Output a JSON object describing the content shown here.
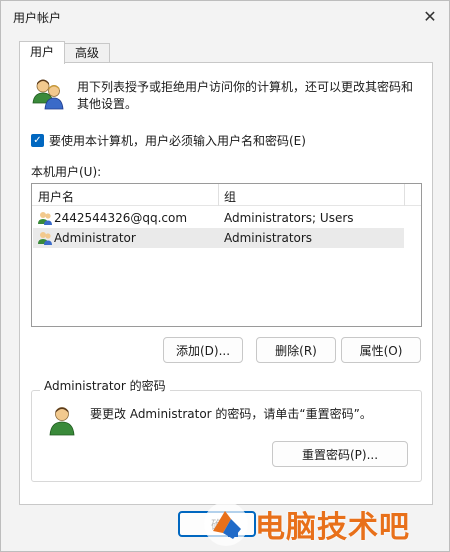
{
  "window": {
    "title": "用户帐户",
    "close_glyph": "✕"
  },
  "tabs": [
    {
      "label": "用户",
      "active": true
    },
    {
      "label": "高级",
      "active": false
    }
  ],
  "intro_text": "用下列表授予或拒绝用户访问你的计算机，还可以更改其密码和其他设置。",
  "checkbox": {
    "label": "要使用本计算机，用户必须输入用户名和密码(E)",
    "checked": true
  },
  "local_users_label": "本机用户(U):",
  "list": {
    "columns": [
      "用户名",
      "组"
    ],
    "rows": [
      {
        "name": "2442544326@qq.com",
        "group": "Administrators; Users",
        "selected": false
      },
      {
        "name": "Administrator",
        "group": "Administrators",
        "selected": true
      }
    ]
  },
  "buttons": {
    "add": "添加(D)...",
    "delete": "删除(R)",
    "properties": "属性(O)"
  },
  "password_group": {
    "title": "Administrator 的密码",
    "text": "要更改 Administrator 的密码，请单击“重置密码”。",
    "reset_button": "重置密码(P)..."
  },
  "bottom": {
    "ok_label": "确"
  },
  "watermark": {
    "text": "电脑技术吧"
  },
  "colors": {
    "accent": "#0067c0",
    "watermark": "#e8701a"
  }
}
